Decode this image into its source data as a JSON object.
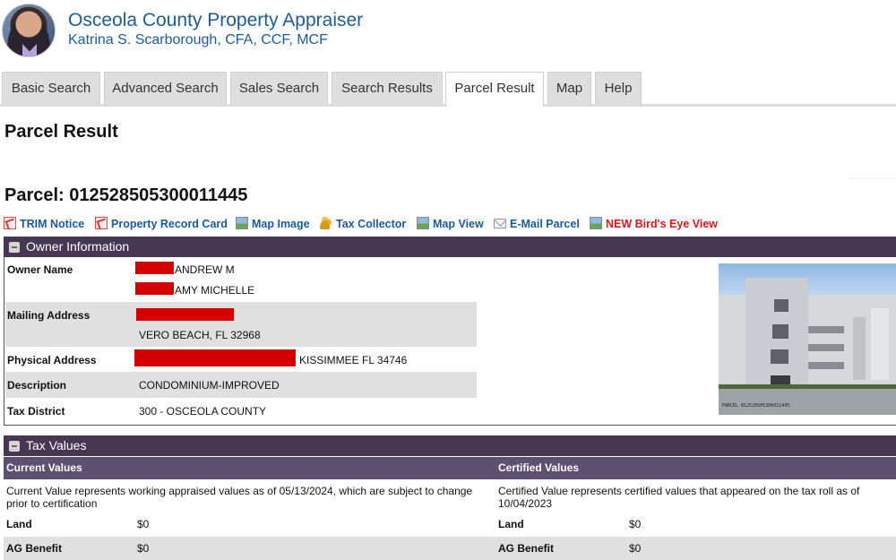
{
  "header": {
    "title": "Osceola County Property Appraiser",
    "subtitle": "Katrina S. Scarborough, CFA, CCF, MCF"
  },
  "tabs": [
    {
      "label": "Basic Search",
      "active": false
    },
    {
      "label": "Advanced Search",
      "active": false
    },
    {
      "label": "Sales Search",
      "active": false
    },
    {
      "label": "Search Results",
      "active": false
    },
    {
      "label": "Parcel Result",
      "active": true
    },
    {
      "label": "Map",
      "active": false
    },
    {
      "label": "Help",
      "active": false
    }
  ],
  "page_title": "Parcel Result",
  "parcel": {
    "label": "Parcel:",
    "number": "012528505300011445",
    "heading": "Parcel: 012528505300011445"
  },
  "links": [
    {
      "label": "TRIM Notice",
      "icon": "pdf-icon"
    },
    {
      "label": "Property Record Card",
      "icon": "pdf-icon"
    },
    {
      "label": "Map Image",
      "icon": "image-icon"
    },
    {
      "label": "Tax Collector",
      "icon": "coins-icon"
    },
    {
      "label": "Map View",
      "icon": "image-icon"
    },
    {
      "label": "E-Mail Parcel",
      "icon": "envelope-icon"
    },
    {
      "label": "NEW Bird's Eye View",
      "icon": "image-icon",
      "color": "#e0131b"
    }
  ],
  "owner_info": {
    "title": "Owner Information",
    "rows": [
      {
        "label": "Owner Name",
        "values": [
          "ANDREW M",
          "AMY MICHELLE"
        ],
        "redacted": true
      },
      {
        "label": "Mailing Address",
        "values": [
          "",
          "VERO BEACH, FL 32968"
        ],
        "redacted": true
      },
      {
        "label": "Physical Address",
        "values": [
          "KISSIMMEE FL 34746"
        ],
        "redacted": true
      },
      {
        "label": "Description",
        "values": [
          "CONDOMINIUM-IMPROVED"
        ]
      },
      {
        "label": "Tax District",
        "values": [
          "300 - OSCEOLA COUNTY"
        ]
      }
    ],
    "photo_alt": "Property photo of condominium building"
  },
  "tax_values": {
    "title": "Tax Values",
    "current": {
      "heading": "Current Values",
      "note": "Current Value represents working appraised values as of 05/13/2024, which are subject to change prior to certification",
      "rows": [
        {
          "label": "Land",
          "value": "$0"
        },
        {
          "label": "AG Benefit",
          "value": "$0"
        }
      ]
    },
    "certified": {
      "heading": "Certified Values",
      "note": "Certified Value represents certified values that appeared on the tax roll as of 10/04/2023",
      "rows": [
        {
          "label": "Land",
          "value": "$0"
        },
        {
          "label": "AG Benefit",
          "value": "$0"
        }
      ]
    }
  },
  "colors": {
    "brand_blue": "#1e5b95",
    "panel_header": "#473752",
    "sub_header": "#5e5070",
    "link_blue": "#1a5a9a",
    "link_red": "#e0131b",
    "redaction": "#d40000"
  }
}
